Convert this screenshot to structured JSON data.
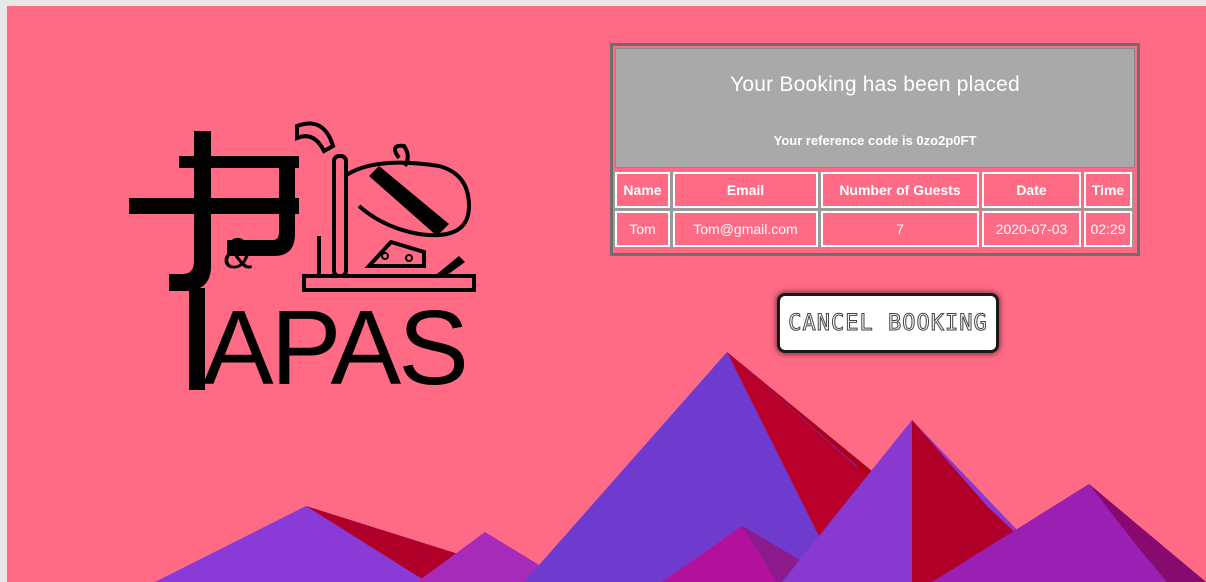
{
  "booking": {
    "title": "Your Booking has been placed",
    "reference_text": "Your reference code is 0zo2p0FT",
    "columns": [
      "Name",
      "Email",
      "Number of Guests",
      "Date",
      "Time"
    ],
    "row": [
      "Tom",
      "Tom@gmail.com",
      "7",
      "2020-07-03",
      "02:29"
    ]
  },
  "actions": {
    "cancel_label": "CANCEL BOOKING"
  },
  "logo": {
    "text": "J&J TAPAS"
  },
  "colors": {
    "background": "#ff6b85",
    "header_gray": "#a9a9a9",
    "mountain_purple": "#6f3bcf",
    "mountain_red": "#b0002a"
  }
}
